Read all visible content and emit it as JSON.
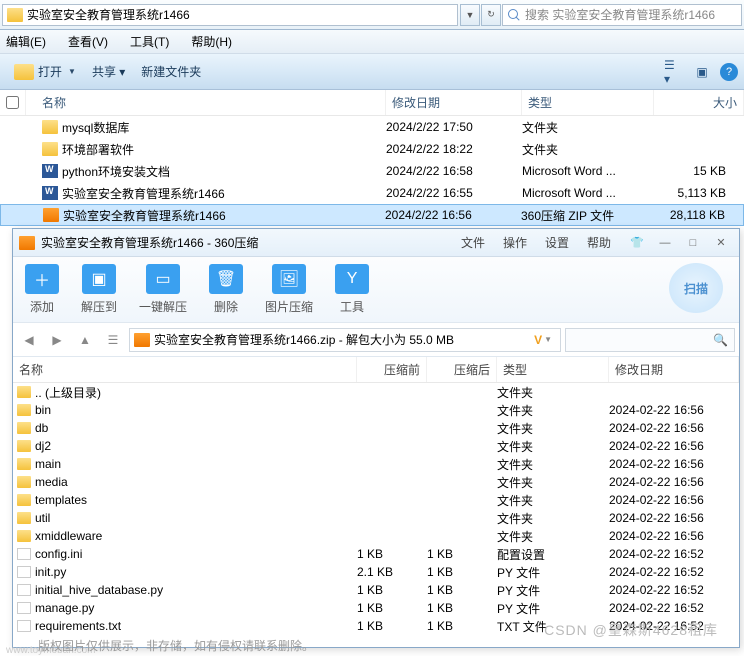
{
  "address": {
    "path": "实验室安全教育管理系统r1466",
    "search_placeholder": "搜索 实验室安全教育管理系统r1466"
  },
  "menu": {
    "edit": "编辑(E)",
    "view": "查看(V)",
    "tools": "工具(T)",
    "help": "帮助(H)"
  },
  "toolbar": {
    "open": "打开",
    "share": "共享 ▾",
    "new_folder": "新建文件夹"
  },
  "columns": {
    "name": "名称",
    "date": "修改日期",
    "type": "类型",
    "size": "大小"
  },
  "files": [
    {
      "icon": "folder",
      "name": "mysql数据库",
      "date": "2024/2/22 17:50",
      "type": "文件夹",
      "size": ""
    },
    {
      "icon": "folder",
      "name": "环境部署软件",
      "date": "2024/2/22 18:22",
      "type": "文件夹",
      "size": ""
    },
    {
      "icon": "word",
      "name": "python环境安装文档",
      "date": "2024/2/22 16:58",
      "type": "Microsoft Word ...",
      "size": "15 KB"
    },
    {
      "icon": "word",
      "name": "实验室安全教育管理系统r1466",
      "date": "2024/2/22 16:55",
      "type": "Microsoft Word ...",
      "size": "5,113 KB"
    },
    {
      "icon": "zip",
      "name": "实验室安全教育管理系统r1466",
      "date": "2024/2/22 16:56",
      "type": "360压缩 ZIP 文件",
      "size": "28,118 KB",
      "selected": true
    }
  ],
  "zip": {
    "title": "实验室安全教育管理系统r1466 - 360压缩",
    "menu": {
      "file": "文件",
      "operate": "操作",
      "settings": "设置",
      "help": "帮助"
    },
    "tools": {
      "add": "添加",
      "extract_to": "解压到",
      "one_click": "一键解压",
      "delete": "删除",
      "img_compress": "图片压缩",
      "tools": "工具",
      "scan": "扫描"
    },
    "path": "实验室安全教育管理系统r1466.zip - 解包大小为 55.0 MB",
    "columns": {
      "name": "名称",
      "before": "压缩前",
      "after": "压缩后",
      "type": "类型",
      "date": "修改日期"
    },
    "rows": [
      {
        "icon": "folder",
        "name": ".. (上级目录)",
        "before": "",
        "after": "",
        "type": "文件夹",
        "date": ""
      },
      {
        "icon": "folder",
        "name": "bin",
        "before": "",
        "after": "",
        "type": "文件夹",
        "date": "2024-02-22 16:56"
      },
      {
        "icon": "folder",
        "name": "db",
        "before": "",
        "after": "",
        "type": "文件夹",
        "date": "2024-02-22 16:56"
      },
      {
        "icon": "folder",
        "name": "dj2",
        "before": "",
        "after": "",
        "type": "文件夹",
        "date": "2024-02-22 16:56"
      },
      {
        "icon": "folder",
        "name": "main",
        "before": "",
        "after": "",
        "type": "文件夹",
        "date": "2024-02-22 16:56"
      },
      {
        "icon": "folder",
        "name": "media",
        "before": "",
        "after": "",
        "type": "文件夹",
        "date": "2024-02-22 16:56"
      },
      {
        "icon": "folder",
        "name": "templates",
        "before": "",
        "after": "",
        "type": "文件夹",
        "date": "2024-02-22 16:56"
      },
      {
        "icon": "folder",
        "name": "util",
        "before": "",
        "after": "",
        "type": "文件夹",
        "date": "2024-02-22 16:56"
      },
      {
        "icon": "folder",
        "name": "xmiddleware",
        "before": "",
        "after": "",
        "type": "文件夹",
        "date": "2024-02-22 16:56"
      },
      {
        "icon": "file",
        "name": "config.ini",
        "before": "1 KB",
        "after": "1 KB",
        "type": "配置设置",
        "date": "2024-02-22 16:52"
      },
      {
        "icon": "file",
        "name": "init.py",
        "before": "2.1 KB",
        "after": "1 KB",
        "type": "PY 文件",
        "date": "2024-02-22 16:52"
      },
      {
        "icon": "file",
        "name": "initial_hive_database.py",
        "before": "1 KB",
        "after": "1 KB",
        "type": "PY 文件",
        "date": "2024-02-22 16:52"
      },
      {
        "icon": "file",
        "name": "manage.py",
        "before": "1 KB",
        "after": "1 KB",
        "type": "PY 文件",
        "date": "2024-02-22 16:52"
      },
      {
        "icon": "file",
        "name": "requirements.txt",
        "before": "1 KB",
        "after": "1 KB",
        "type": "TXT 文件",
        "date": "2024-02-22 16:52"
      }
    ]
  },
  "watermark_main": "版权图片仅供展示，非存储，如有侵权请联系删除。",
  "watermark_csdn": "CSDN @皇森斯4628租库",
  "watermark_url": "www.toymoban.com"
}
